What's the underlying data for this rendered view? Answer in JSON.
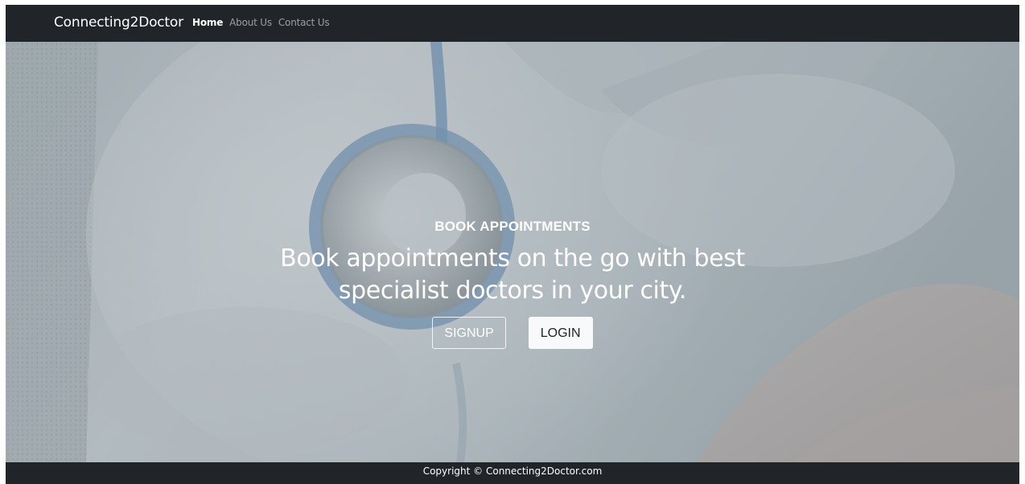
{
  "navbar": {
    "brand": "Connecting2Doctor",
    "links": [
      {
        "label": "Home",
        "active": true
      },
      {
        "label": "About Us",
        "active": false
      },
      {
        "label": "Contact Us",
        "active": false
      }
    ]
  },
  "hero": {
    "eyebrow": "BOOK APPOINTMENTS",
    "title": "Book appointments on the go with best specialist doctors in your city.",
    "signup_label": "SIGNUP",
    "login_label": "LOGIN"
  },
  "footer": {
    "copyright": "Copyright © Connecting2Doctor.com"
  },
  "colors": {
    "navbar_bg": "#212529",
    "hero_overlay": "#5f6e78",
    "text_light": "#ffffff",
    "button_light_bg": "#f8f9fa"
  }
}
